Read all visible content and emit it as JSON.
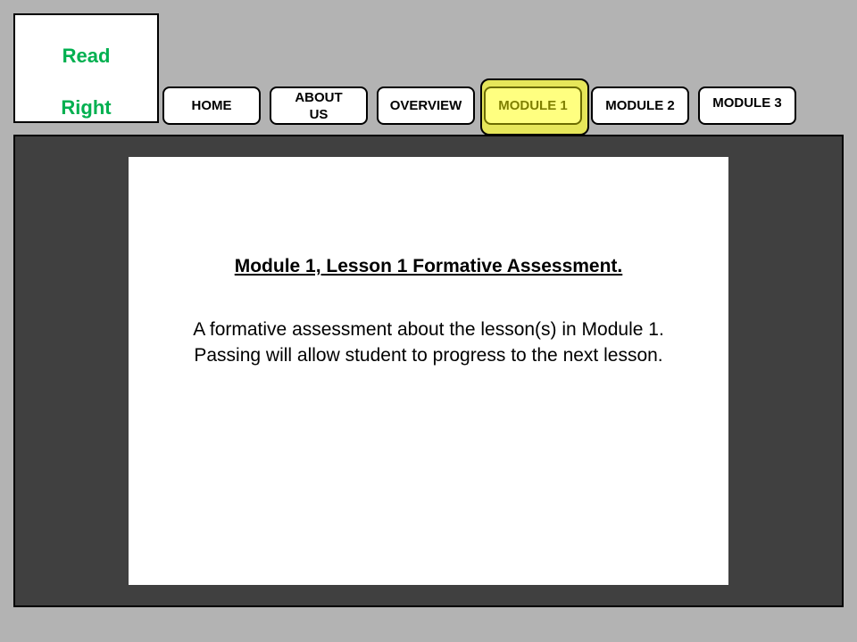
{
  "logo": {
    "line1": "Read",
    "line2": "Right",
    "color": "#00b050"
  },
  "nav": {
    "items": [
      {
        "label": "HOME",
        "active": false
      },
      {
        "label": "ABOUT US",
        "active": false
      },
      {
        "label": "OVERVIEW",
        "active": false
      },
      {
        "label": "MODULE 1",
        "active": true
      },
      {
        "label": "MODULE 2",
        "active": false
      },
      {
        "label": "MODULE 3",
        "active": false
      }
    ],
    "active_color": "#ffff80"
  },
  "content": {
    "title": "Module 1, Lesson 1 Formative Assessment.",
    "description_line1": "A formative assessment about the lesson(s) in Module 1.",
    "description_line2": "Passing will allow student to progress to the next lesson."
  },
  "colors": {
    "background": "#b3b3b3",
    "frame": "#404040",
    "page": "#ffffff"
  }
}
